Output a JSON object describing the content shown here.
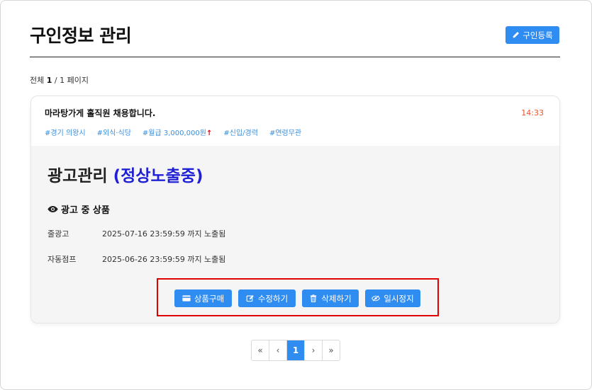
{
  "header": {
    "title": "구인정보 관리",
    "register_label": "구인등록",
    "register_icon": "pencil-icon"
  },
  "summary": {
    "prefix": "전체",
    "current": "1",
    "rest": "/ 1 페이지"
  },
  "post": {
    "title": "마라탕가게 홀직원 채용합니다.",
    "time": "14:33",
    "tags": [
      {
        "text": "#경기 의왕시",
        "arrow": ""
      },
      {
        "text": "#외식·식당",
        "arrow": ""
      },
      {
        "text": "#월급 3,000,000원",
        "arrow": "↑"
      },
      {
        "text": "#신입/경력",
        "arrow": ""
      },
      {
        "text": "#연령무관",
        "arrow": ""
      }
    ]
  },
  "ad": {
    "title": "광고관리",
    "status": "(정상노출중)",
    "section_label": "광고 중 상품",
    "section_icon": "eye-icon",
    "products": [
      {
        "name": "줄광고",
        "detail": "2025-07-16 23:59:59 까지 노출됨"
      },
      {
        "name": "자동점프",
        "detail": "2025-06-26 23:59:59 까지 노출됨"
      }
    ]
  },
  "actions": {
    "buy": {
      "label": "상품구매",
      "icon": "credit-card-icon"
    },
    "edit": {
      "label": "수정하기",
      "icon": "edit-icon"
    },
    "delete": {
      "label": "삭제하기",
      "icon": "trash-icon"
    },
    "pause": {
      "label": "일시정지",
      "icon": "eye-slash-icon"
    }
  },
  "pagination": {
    "first": "«",
    "prev": "‹",
    "current": "1",
    "next": "›",
    "last": "»"
  },
  "colors": {
    "accent": "#2f8cf0",
    "time": "#e8552a",
    "status": "#1f1fd6",
    "highlight": "#e00000",
    "tag": "#3b8ede"
  }
}
